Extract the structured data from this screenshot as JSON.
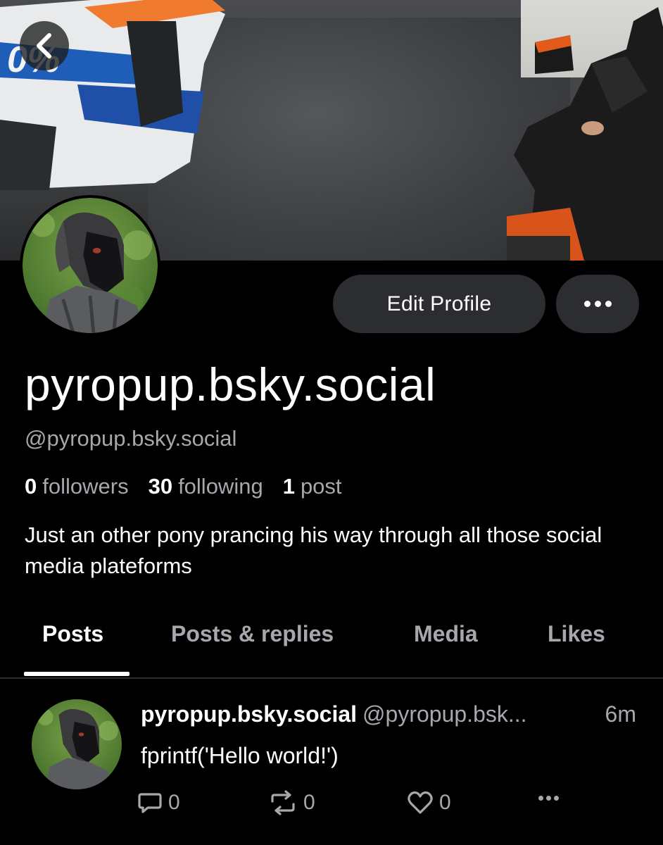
{
  "header": {
    "back_icon": "chevron-left-icon"
  },
  "profile": {
    "display_name": "pyropup.bsky.social",
    "handle": "@pyropup.bsky.social",
    "followers_count": "0",
    "followers_label": "followers",
    "following_count": "30",
    "following_label": "following",
    "posts_count": "1",
    "posts_label": "post",
    "bio": "Just an other pony prancing his way through all those social media plateforms",
    "edit_button_label": "Edit Profile",
    "more_icon": "ellipsis-icon"
  },
  "tabs": [
    {
      "label": "Posts",
      "active": true
    },
    {
      "label": "Posts & replies",
      "active": false
    },
    {
      "label": "Media",
      "active": false
    },
    {
      "label": "Likes",
      "active": false
    }
  ],
  "post": {
    "author": "pyropup.bsky.social",
    "handle": "@pyropup.bsk...",
    "time": "6m",
    "text": "fprintf('Hello world!')",
    "reply_count": "0",
    "repost_count": "0",
    "like_count": "0"
  },
  "colors": {
    "background": "#000000",
    "secondary_text": "#a6a8ad",
    "button_bg": "#2c2d31"
  }
}
